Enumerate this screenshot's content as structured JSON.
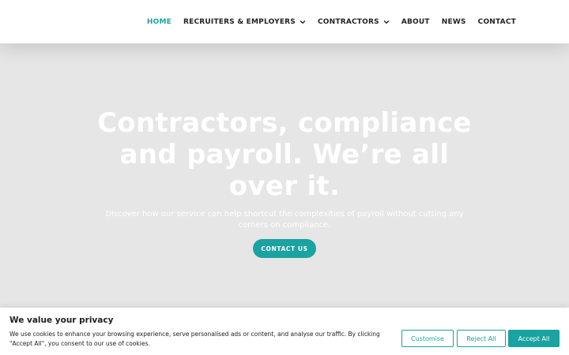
{
  "nav": {
    "items": [
      {
        "label": "HOME",
        "active": true,
        "has_dropdown": false
      },
      {
        "label": "RECRUITERS & EMPLOYERS",
        "active": false,
        "has_dropdown": true
      },
      {
        "label": "CONTRACTORS",
        "active": false,
        "has_dropdown": true
      },
      {
        "label": "ABOUT",
        "active": false,
        "has_dropdown": false
      },
      {
        "label": "NEWS",
        "active": false,
        "has_dropdown": false
      },
      {
        "label": "CONTACT",
        "active": false,
        "has_dropdown": false
      }
    ],
    "dropdown_icon": "chevron-down-icon"
  },
  "hero": {
    "title": "Contractors, compliance and payroll. We’re all over it.",
    "subtitle": "Discover how our service can help shortcut the complexities of payroll without cutting any corners on compliance.",
    "cta_label": "CONTACT US"
  },
  "cookie_banner": {
    "title": "We value your privacy",
    "text": "We use cookies to enhance your browsing experience, serve personalised ads or content, and analyse our traffic. By clicking \"Accept All\", you consent to our use of cookies.",
    "customise_label": "Customise",
    "reject_label": "Reject All",
    "accept_label": "Accept All"
  },
  "colors": {
    "accent": "#1aa3a0",
    "hero_background": "#e6e6e6",
    "nav_text": "#222222"
  }
}
